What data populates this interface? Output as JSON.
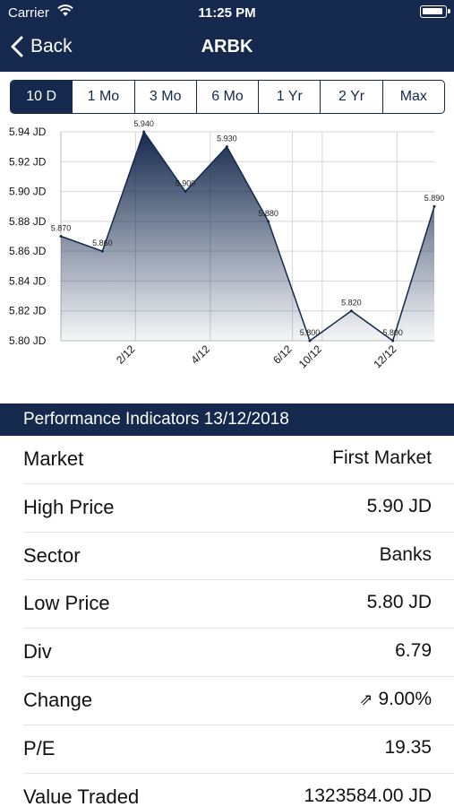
{
  "status_bar": {
    "carrier": "Carrier",
    "time": "11:25 PM"
  },
  "nav": {
    "back_label": "Back",
    "title": "ARBK"
  },
  "ranges": [
    "10 D",
    "1 Mo",
    "3 Mo",
    "6 Mo",
    "1 Yr",
    "2 Yr",
    "Max"
  ],
  "selected_range": "10 D",
  "chart_data": {
    "type": "area",
    "x": [
      1,
      2,
      3,
      4,
      5,
      6,
      7,
      8,
      9,
      10,
      11,
      12
    ],
    "values": [
      5.87,
      5.86,
      5.94,
      5.9,
      5.93,
      5.88,
      5.8,
      5.82,
      5.8,
      5.89
    ],
    "point_x": [
      1,
      2,
      3,
      4,
      5,
      6,
      8,
      9,
      10,
      11
    ],
    "point_labels": [
      "5.870",
      "5.860",
      "5.940",
      "5.900",
      "5.930",
      "5.880",
      "5.800",
      "5.820",
      "5.800",
      "5.890"
    ],
    "x_ticks": [
      {
        "x": 2,
        "label": "2/12"
      },
      {
        "x": 4,
        "label": "4/12"
      },
      {
        "x": 6,
        "label": "6/12"
      },
      {
        "x": 10,
        "label": "10/12"
      },
      {
        "x": 12,
        "label": "12/12"
      }
    ],
    "y_ticks": [
      "5.94 JD",
      "5.92 JD",
      "5.90 JD",
      "5.88 JD",
      "5.86 JD",
      "5.84 JD",
      "5.82 JD",
      "5.80 JD"
    ],
    "ylim": [
      5.8,
      5.94
    ],
    "grid": true,
    "fill_color": "#14294d",
    "line_color": "#14294d"
  },
  "performance": {
    "title": "Performance Indicators 13/12/2018",
    "rows": [
      {
        "label": "Market",
        "value": "First Market"
      },
      {
        "label": "High Price",
        "value": "5.90 JD"
      },
      {
        "label": "Sector",
        "value": "Banks"
      },
      {
        "label": "Low Price",
        "value": "5.80 JD"
      },
      {
        "label": "Div",
        "value": "6.79"
      },
      {
        "label": "Change",
        "value": "9.00%",
        "icon": "arrow-up-right-icon"
      },
      {
        "label": "P/E",
        "value": "19.35"
      },
      {
        "label": "Value Traded",
        "value": "1323584.00 JD"
      }
    ]
  },
  "colors": {
    "primary": "#14294d",
    "background": "#ffffff",
    "separator": "#e2e2e2"
  }
}
